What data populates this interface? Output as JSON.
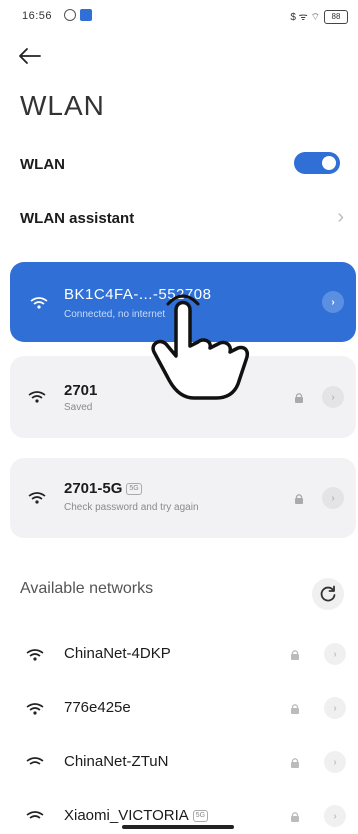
{
  "status_bar": {
    "time": "16:56",
    "right_text": "$ ᯤ ⌔",
    "battery": "88"
  },
  "header": {
    "title": "WLAN"
  },
  "wlan_toggle": {
    "label": "WLAN",
    "enabled": true
  },
  "assistant": {
    "label": "WLAN assistant"
  },
  "connected_network": {
    "name": "BK1C4FA-...-552708",
    "status": "Connected, no internet"
  },
  "saved_networks": [
    {
      "name": "2701",
      "status": "Saved",
      "tag": ""
    },
    {
      "name": "2701-5G",
      "status": "Check password and try again",
      "tag": "5G"
    }
  ],
  "available": {
    "label": "Available networks",
    "networks": [
      {
        "name": "ChinaNet-4DKP",
        "tag": ""
      },
      {
        "name": "776e425e",
        "tag": ""
      },
      {
        "name": "ChinaNet-ZTuN",
        "tag": ""
      },
      {
        "name": "Xiaomi_VICTORIA",
        "tag": "5G"
      }
    ]
  },
  "colors": {
    "accent": "#2f6fd6",
    "card_grey": "#f2f2f4",
    "text_primary": "#1b1b1b",
    "text_secondary": "#8a8a8a"
  }
}
